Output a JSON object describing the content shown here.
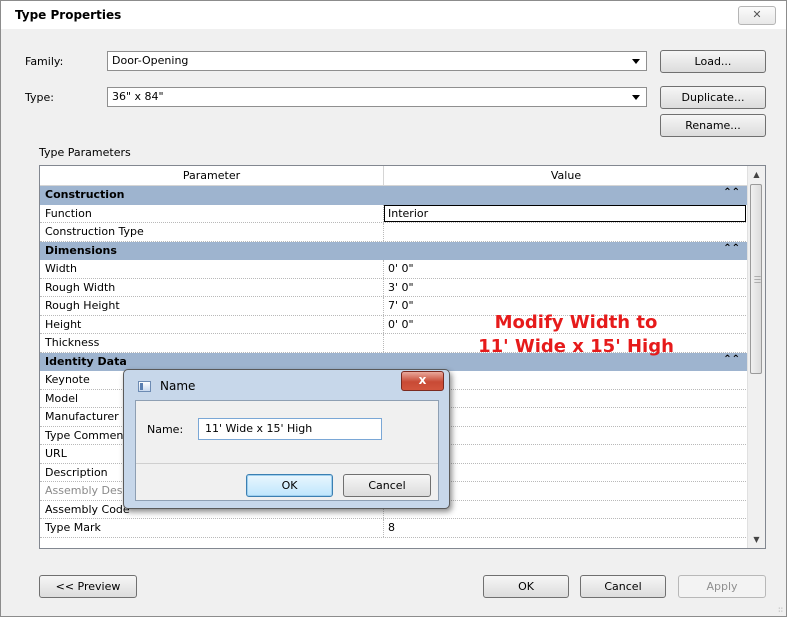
{
  "window": {
    "title": "Type Properties",
    "close_glyph": "✕"
  },
  "family": {
    "label": "Family:",
    "value": "Door-Opening"
  },
  "type": {
    "label": "Type:",
    "value": "36\" x 84\""
  },
  "buttons": {
    "load": "Load...",
    "duplicate": "Duplicate...",
    "rename": "Rename...",
    "preview": "<< Preview",
    "ok": "OK",
    "cancel": "Cancel",
    "apply": "Apply"
  },
  "type_parameters_label": "Type Parameters",
  "table": {
    "headers": [
      "Parameter",
      "Value"
    ],
    "groups": [
      {
        "name": "Construction",
        "rows": [
          {
            "param": "Function",
            "value": "Interior"
          },
          {
            "param": "Construction Type",
            "value": ""
          }
        ]
      },
      {
        "name": "Dimensions",
        "rows": [
          {
            "param": "Width",
            "value": "0'  0\""
          },
          {
            "param": "Rough Width",
            "value": "3'  0\""
          },
          {
            "param": "Rough Height",
            "value": "7'  0\""
          },
          {
            "param": "Height",
            "value": "0'  0\""
          },
          {
            "param": "Thickness",
            "value": ""
          }
        ]
      },
      {
        "name": "Identity Data",
        "rows": [
          {
            "param": "Keynote",
            "value": ""
          },
          {
            "param": "Model",
            "value": ""
          },
          {
            "param": "Manufacturer",
            "value": ""
          },
          {
            "param": "Type Comments",
            "value": ""
          },
          {
            "param": "URL",
            "value": ""
          },
          {
            "param": "Description",
            "value": ""
          },
          {
            "param": "Assembly Description",
            "value": ""
          },
          {
            "param": "Assembly Code",
            "value": ""
          },
          {
            "param": "Type Mark",
            "value": "8"
          }
        ]
      }
    ]
  },
  "annotation": {
    "line1": "Modify Width to",
    "line2": "11' Wide x 15' High",
    "color": "#e61b1b"
  },
  "name_dialog": {
    "title": "Name",
    "name_label": "Name:",
    "name_value": "11' Wide x 15' High",
    "ok": "OK",
    "cancel": "Cancel",
    "close_glyph": "x"
  }
}
